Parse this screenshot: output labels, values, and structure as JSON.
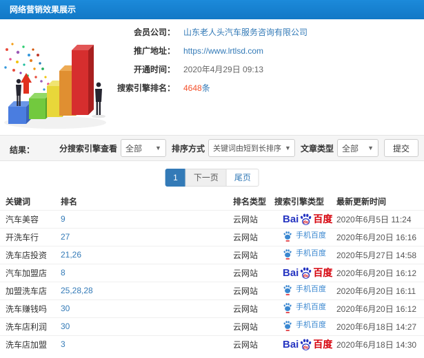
{
  "header": {
    "title": "网络营销效果展示"
  },
  "info": {
    "rows": [
      {
        "label": "会员公司：",
        "value": "山东老人头汽车服务咨询有限公司",
        "type": "link"
      },
      {
        "label": "推广地址：",
        "value": "https://www.lrtlsd.com",
        "type": "link"
      },
      {
        "label": "开通时间：",
        "value": "2020年4月29日 09:13",
        "type": "text"
      },
      {
        "label": "搜索引擎排名：",
        "value": "4648",
        "suffix": "条",
        "type": "highlight"
      }
    ]
  },
  "filters": {
    "result_label": "结果：",
    "engine_label": "分搜索引擎查看",
    "engine_value": "全部",
    "sort_label": "排序方式",
    "sort_value": "关键词由短到长排序",
    "article_label": "文章类型",
    "article_value": "全部",
    "submit_label": "提交",
    "caret_glyph": "▼"
  },
  "pagination": {
    "current": "1",
    "next": "下一页",
    "last": "尾页"
  },
  "table": {
    "headers": [
      "关键词",
      "排名",
      "排名类型",
      "搜索引擎类型",
      "最新更新时间"
    ],
    "engine_labels": {
      "baidu_bai": "Bai",
      "baidu_du": "du",
      "baidu_cn": "百度",
      "mobile_label": "手机百度"
    },
    "rows": [
      {
        "keyword": "汽车美容",
        "rank": "9",
        "rank_type": "云网站",
        "engine": "baidu",
        "updated": "2020年6月5日 11:24"
      },
      {
        "keyword": "开洗车行",
        "rank": "27",
        "rank_type": "云网站",
        "engine": "mobile",
        "updated": "2020年6月20日 16:16"
      },
      {
        "keyword": "洗车店投资",
        "rank": "21,26",
        "rank_type": "云网站",
        "engine": "mobile",
        "updated": "2020年5月27日 14:58"
      },
      {
        "keyword": "汽车加盟店",
        "rank": "8",
        "rank_type": "云网站",
        "engine": "baidu",
        "updated": "2020年6月20日 16:12"
      },
      {
        "keyword": "加盟洗车店",
        "rank": "25,28,28",
        "rank_type": "云网站",
        "engine": "mobile",
        "updated": "2020年6月20日 16:11"
      },
      {
        "keyword": "洗车赚钱吗",
        "rank": "30",
        "rank_type": "云网站",
        "engine": "mobile",
        "updated": "2020年6月20日 16:12"
      },
      {
        "keyword": "洗车店利润",
        "rank": "30",
        "rank_type": "云网站",
        "engine": "mobile",
        "updated": "2020年6月18日 14:27"
      },
      {
        "keyword": "洗车店加盟",
        "rank": "3",
        "rank_type": "云网站",
        "engine": "baidu",
        "updated": "2020年6月18日 14:30"
      }
    ]
  },
  "colors": {
    "header_blue": "#1583d3",
    "link_blue": "#337ab7",
    "rank_orange": "#f4512c",
    "baidu_blue": "#2534c1",
    "baidu_red": "#d6010b",
    "mobile_blue": "#3a87d0",
    "filter_bg": "#f5f5f5"
  }
}
